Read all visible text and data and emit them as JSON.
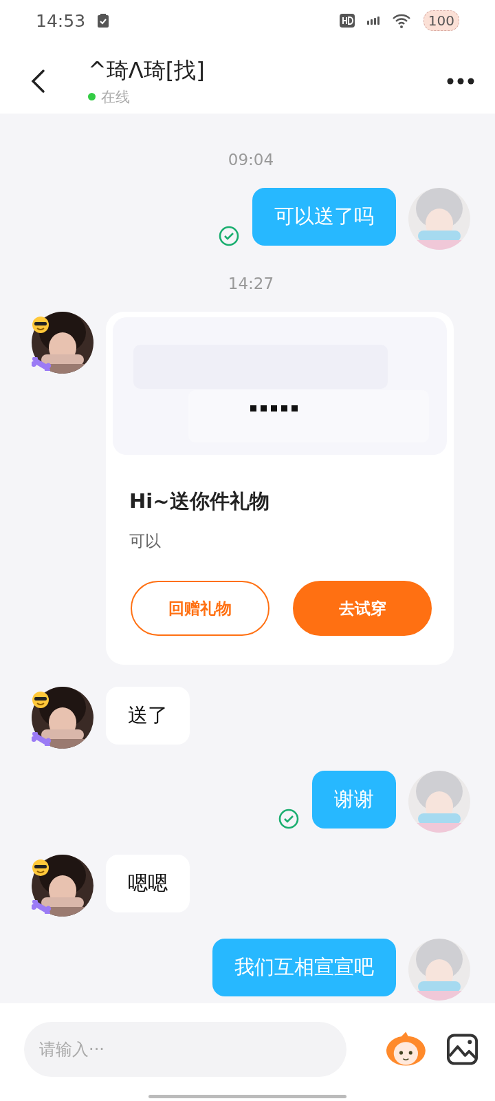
{
  "status_bar": {
    "time": "14:53",
    "battery": "100"
  },
  "header": {
    "title": "^琦Λ琦[找]",
    "online": true,
    "presence": "在线"
  },
  "messages": [
    {
      "kind": "time",
      "text": "09:04"
    },
    {
      "kind": "sent",
      "text": "可以送了吗",
      "read": true
    },
    {
      "kind": "time",
      "text": "14:27"
    },
    {
      "kind": "gift",
      "title": "Hi~送你件礼物",
      "subtitle": "可以",
      "buttons": [
        "回赠礼物",
        "去试穿"
      ]
    },
    {
      "kind": "received",
      "text": "送了"
    },
    {
      "kind": "sent",
      "text": "谢谢",
      "read": true
    },
    {
      "kind": "received",
      "text": "嗯嗯"
    },
    {
      "kind": "sent",
      "text": "我们互相宣宣吧"
    }
  ],
  "composer": {
    "placeholder": "请输入···"
  }
}
